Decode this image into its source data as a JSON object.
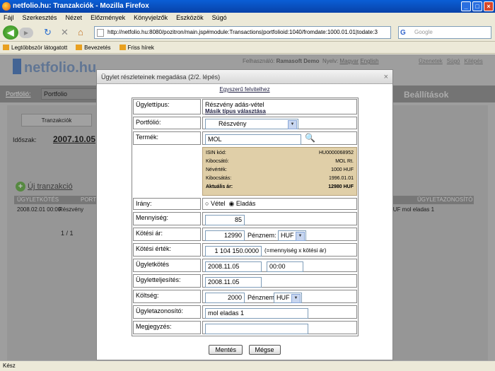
{
  "browser": {
    "title": "netfolio.hu: Tranzakciók - Mozilla Firefox",
    "menu": [
      "Fájl",
      "Szerkesztés",
      "Nézet",
      "Előzmények",
      "Könyvjelzők",
      "Eszközök",
      "Súgó"
    ],
    "url": "http://netfolio.hu:8080/pozitron/main.jsp#module:Transactions|portfolioid:1040/fromdate:1000.01.01|todate:3",
    "search_placeholder": "Google",
    "bookmarks": [
      "Legtöbbször látogatott",
      "Bevezetés",
      "Friss hírek"
    ],
    "status": "Kész"
  },
  "app": {
    "logo": "netfolio.hu",
    "user_label": "Felhasználó:",
    "user_name": "Ramasoft Demo",
    "lang_label": "Nyelv:",
    "lang_hu": "Magyar",
    "lang_en": "English",
    "links": [
      "Üzenetek",
      "Súgó",
      "Kilépés"
    ],
    "portfolio_label": "Portfólió:",
    "portfolio_value": "Portfolio",
    "settings": "Beállítások",
    "tab": "Tranzakciók",
    "period_label": "Időszak:",
    "period_value": "2007.10.05",
    "new_tx": "Új tranzakció",
    "table_head_left": "ÜGYLETKÖTÉS",
    "table_head_mid": "PORTI",
    "table_head_right": "ÜGYLETAZONOSÍTÓ",
    "row_left": "2008.02.01 00:00",
    "row_mid": "Részvény",
    "row_right": "HUF mol eladas 1",
    "pager": "1 / 1"
  },
  "dialog": {
    "title": "Ügylet részleteinek megadása (2/2. lépés)",
    "simple_link": "Egyszerű felvitelhez",
    "type_label": "Ügylettípus:",
    "type_value": "Részvény adás-vétel",
    "type_change": "Másik típus választása",
    "portfolio_label": "Portfólió:",
    "portfolio_value": "Részvény",
    "product_label": "Termék:",
    "product_value": "MOL",
    "info": [
      {
        "k": "ISIN kód:",
        "v": "HU0000068952"
      },
      {
        "k": "Kibocsátó:",
        "v": "MOL Rt."
      },
      {
        "k": "Névérték:",
        "v": "1000 HUF"
      },
      {
        "k": "Kibocsátás:",
        "v": "1996.01.01"
      },
      {
        "k": "Aktuális ár:",
        "v": "12980 HUF"
      }
    ],
    "direction_label": "Irány:",
    "dir_buy": "Vétel",
    "dir_sell": "Eladás",
    "qty_label": "Mennyiség:",
    "qty_value": "85",
    "price_label": "Kötési ár:",
    "price_value": "12990",
    "currency_label": "Pénznem:",
    "currency_value": "HUF",
    "value_label": "Kötési érték:",
    "value_value": "1 104 150.0000",
    "value_note": "(=mennyiség x kötési ár)",
    "deal_label": "Ügyletkötés",
    "deal_date": "2008.11.05",
    "deal_time": "00:00",
    "settle_label": "Ügyletteljesítés:",
    "settle_date": "2008.11.05",
    "cost_label": "Költség:",
    "cost_value": "2000",
    "cost_currency": "HUF",
    "id_label": "Ügyletazonosító:",
    "id_value": "mol eladas 1",
    "note_label": "Megjegyzés:",
    "note_value": "",
    "save": "Mentés",
    "cancel": "Mégse"
  }
}
